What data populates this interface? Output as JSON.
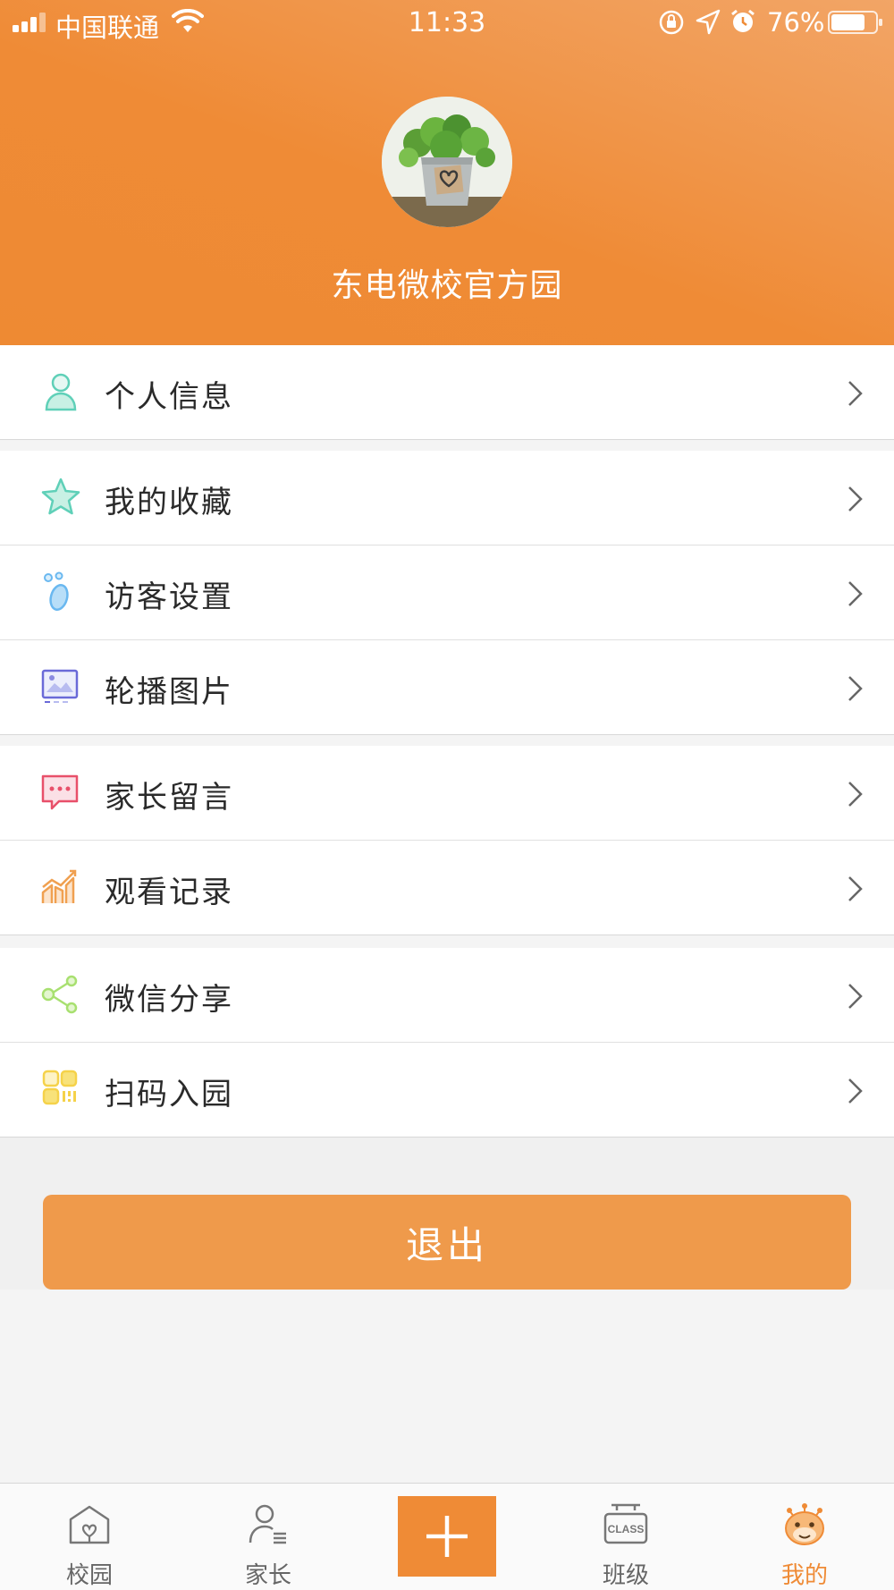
{
  "status_bar": {
    "carrier": "中国联通",
    "time": "11:33",
    "battery_percent": "76%",
    "icons": [
      "signal-icon",
      "wifi-icon",
      "rotation-lock-icon",
      "location-icon",
      "alarm-icon",
      "battery-icon"
    ]
  },
  "profile": {
    "name": "东电微校官方园",
    "avatar": "plant-avatar"
  },
  "menu": {
    "groups": [
      {
        "items": [
          {
            "label": "个人信息",
            "icon": "person-icon",
            "color": "#5fd0b8"
          }
        ]
      },
      {
        "items": [
          {
            "label": "我的收藏",
            "icon": "star-icon",
            "color": "#5fd0b8"
          },
          {
            "label": "访客设置",
            "icon": "visitor-icon",
            "color": "#6ab8f0"
          },
          {
            "label": "轮播图片",
            "icon": "carousel-image-icon",
            "color": "#6a6ad8"
          }
        ]
      },
      {
        "items": [
          {
            "label": "家长留言",
            "icon": "message-icon",
            "color": "#e8506a"
          },
          {
            "label": "观看记录",
            "icon": "chart-icon",
            "color": "#f0a050"
          }
        ]
      },
      {
        "items": [
          {
            "label": "微信分享",
            "icon": "share-icon",
            "color": "#a8e070"
          },
          {
            "label": "扫码入园",
            "icon": "qr-icon",
            "color": "#f5d24a"
          }
        ]
      }
    ]
  },
  "logout": {
    "label": "退出"
  },
  "tabbar": {
    "tabs": [
      {
        "label": "校园",
        "icon": "campus-icon",
        "active": false
      },
      {
        "label": "家长",
        "icon": "parent-icon",
        "active": false
      },
      {
        "label": "",
        "icon": "plus-icon",
        "active": false
      },
      {
        "label": "班级",
        "icon": "class-icon",
        "active": false
      },
      {
        "label": "我的",
        "icon": "mine-icon",
        "active": true
      }
    ]
  },
  "colors": {
    "accent": "#ef8b36",
    "background": "#f4f4f4",
    "logout_button": "#ef9a4b"
  }
}
